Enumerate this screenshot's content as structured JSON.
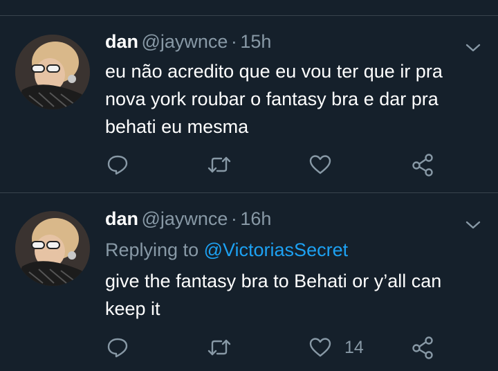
{
  "tweets": [
    {
      "name": "dan",
      "handle": "@jaywnce",
      "separator": "·",
      "time": "15h",
      "replying_prefix": "",
      "replying_to": "",
      "text": "eu não acredito que eu vou ter que ir pra nova york roubar o fantasy bra e dar pra behati eu mesma",
      "like_count": ""
    },
    {
      "name": "dan",
      "handle": "@jaywnce",
      "separator": "·",
      "time": "16h",
      "replying_prefix": "Replying to",
      "replying_to": "@VictoriasSecret",
      "text": "give the fantasy bra to Behati or y’all can keep it",
      "like_count": "14"
    }
  ],
  "icons": {
    "reply": "reply-icon",
    "retweet": "retweet-icon",
    "like": "heart-icon",
    "share": "share-icon",
    "more": "chevron-down-icon"
  },
  "colors": {
    "background": "#15202b",
    "divider": "#38444d",
    "secondary_text": "#8899a6",
    "link": "#1da1f2",
    "primary_text": "#ffffff"
  }
}
